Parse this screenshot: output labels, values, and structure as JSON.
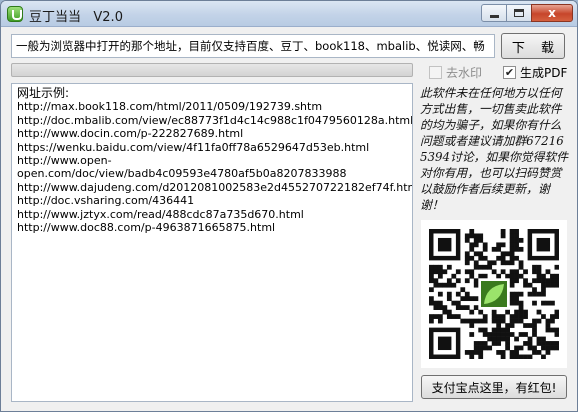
{
  "window": {
    "title": "豆丁当当   V2.0",
    "minimize": "minimize",
    "maximize": "maximize",
    "close_label": "x"
  },
  "toolbar": {
    "url_value": "一般为浏览器中打开的那个地址，目前仅支持百度、豆丁、book118、mbalib、悦读网、畅",
    "download_label": "下 载",
    "watermark_label": "去水印",
    "watermark_checked": false,
    "pdf_label": "生成PDF",
    "pdf_checked": true,
    "progress": 0
  },
  "examples": {
    "header": "网址示例:",
    "lines": [
      "http://max.book118.com/html/2011/0509/192739.shtm",
      "http://doc.mbalib.com/view/ec88773f1d4c14c988c1f0479560128a.html",
      "http://www.docin.com/p-222827689.html",
      "https://wenku.baidu.com/view/4f11fa0ff78a6529647d53eb.html",
      "http://www.open-",
      "open.com/doc/view/badb4c09593e4780af5b0a8207833988",
      "http://www.dajudeng.com/d2012081002583e2d455270722182ef74f.html",
      "http://doc.vsharing.com/436441",
      "http://www.jztyx.com/read/488cdc87a735d670.html",
      "http://www.doc88.com/p-4963871665875.html"
    ]
  },
  "sidebar": {
    "notice": "此软件未在任何地方以任何方式出售，一切售卖此软件的均为骗子，如果你有什么问题或者建议请加群672165394讨论，如果你觉得软件对你有用，也可以扫码赞赏以鼓励作者后续更新，谢谢！",
    "pay_label": "支付宝点这里，有红包!"
  },
  "icons": {
    "app": "app-logo-icon",
    "check": "checkmark-icon",
    "qr": "qr-code-icon"
  },
  "colors": {
    "qr_center": "#3a7a1e"
  }
}
